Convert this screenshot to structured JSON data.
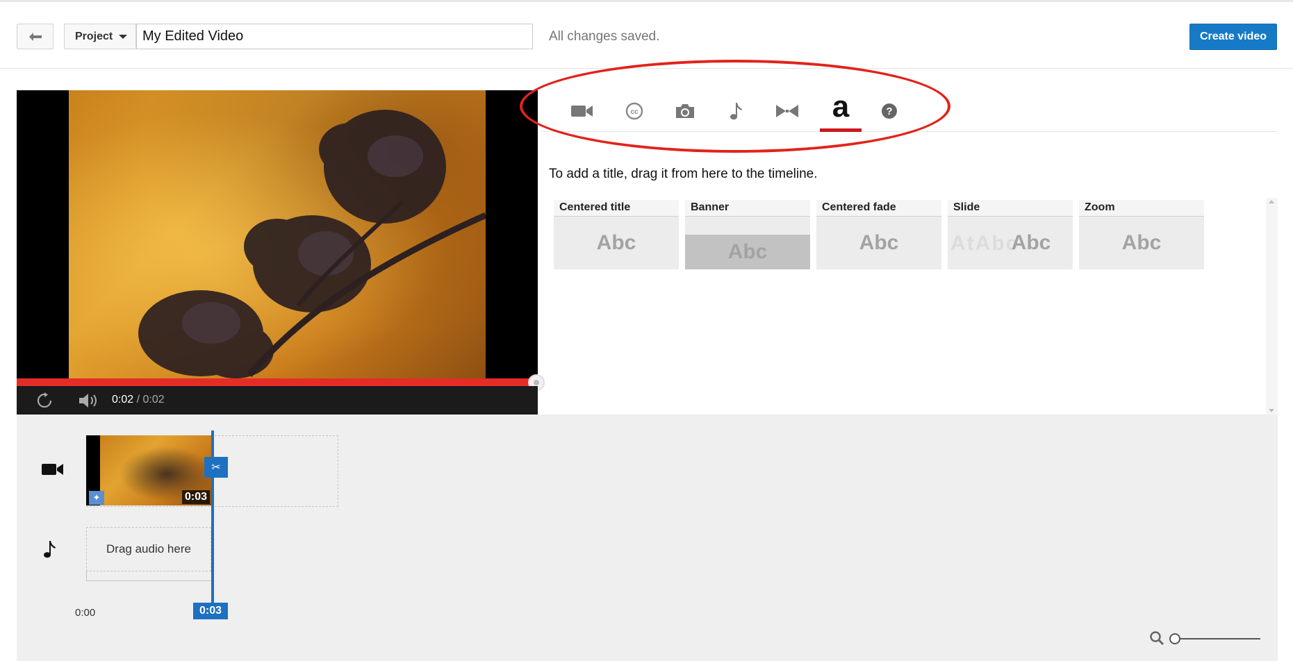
{
  "header": {
    "project_label": "Project",
    "title_value": "My Edited Video",
    "save_status": "All changes saved.",
    "create_label": "Create video"
  },
  "player": {
    "current_time": "0:02",
    "duration": "0:02",
    "progress": 1.0
  },
  "tabs": [
    {
      "icon": "video-camera-icon",
      "active": false
    },
    {
      "icon": "creative-commons-icon",
      "active": false
    },
    {
      "icon": "camera-icon",
      "active": false
    },
    {
      "icon": "music-note-icon",
      "active": false
    },
    {
      "icon": "transitions-icon",
      "active": false
    },
    {
      "icon": "text-a-icon",
      "label": "a",
      "active": true
    },
    {
      "icon": "help-icon",
      "active": false
    }
  ],
  "titles_panel": {
    "instructions": "To add a title, drag it from here to the timeline.",
    "templates": [
      {
        "name": "Centered title",
        "preview": "Abc"
      },
      {
        "name": "Banner",
        "preview": "Abc"
      },
      {
        "name": "Centered fade",
        "preview": "Abc"
      },
      {
        "name": "Slide",
        "preview": "Abc",
        "ghost": "AtAbc"
      },
      {
        "name": "Zoom",
        "preview": "Abc"
      }
    ]
  },
  "timeline": {
    "clip_duration": "0:03",
    "audio_drop_label": "Drag audio here",
    "start_time": "0:00",
    "playhead_time": "0:03"
  },
  "colors": {
    "accent_blue": "#167ac6",
    "progress_red": "#e52d27",
    "annotation_red": "#e1231b"
  }
}
